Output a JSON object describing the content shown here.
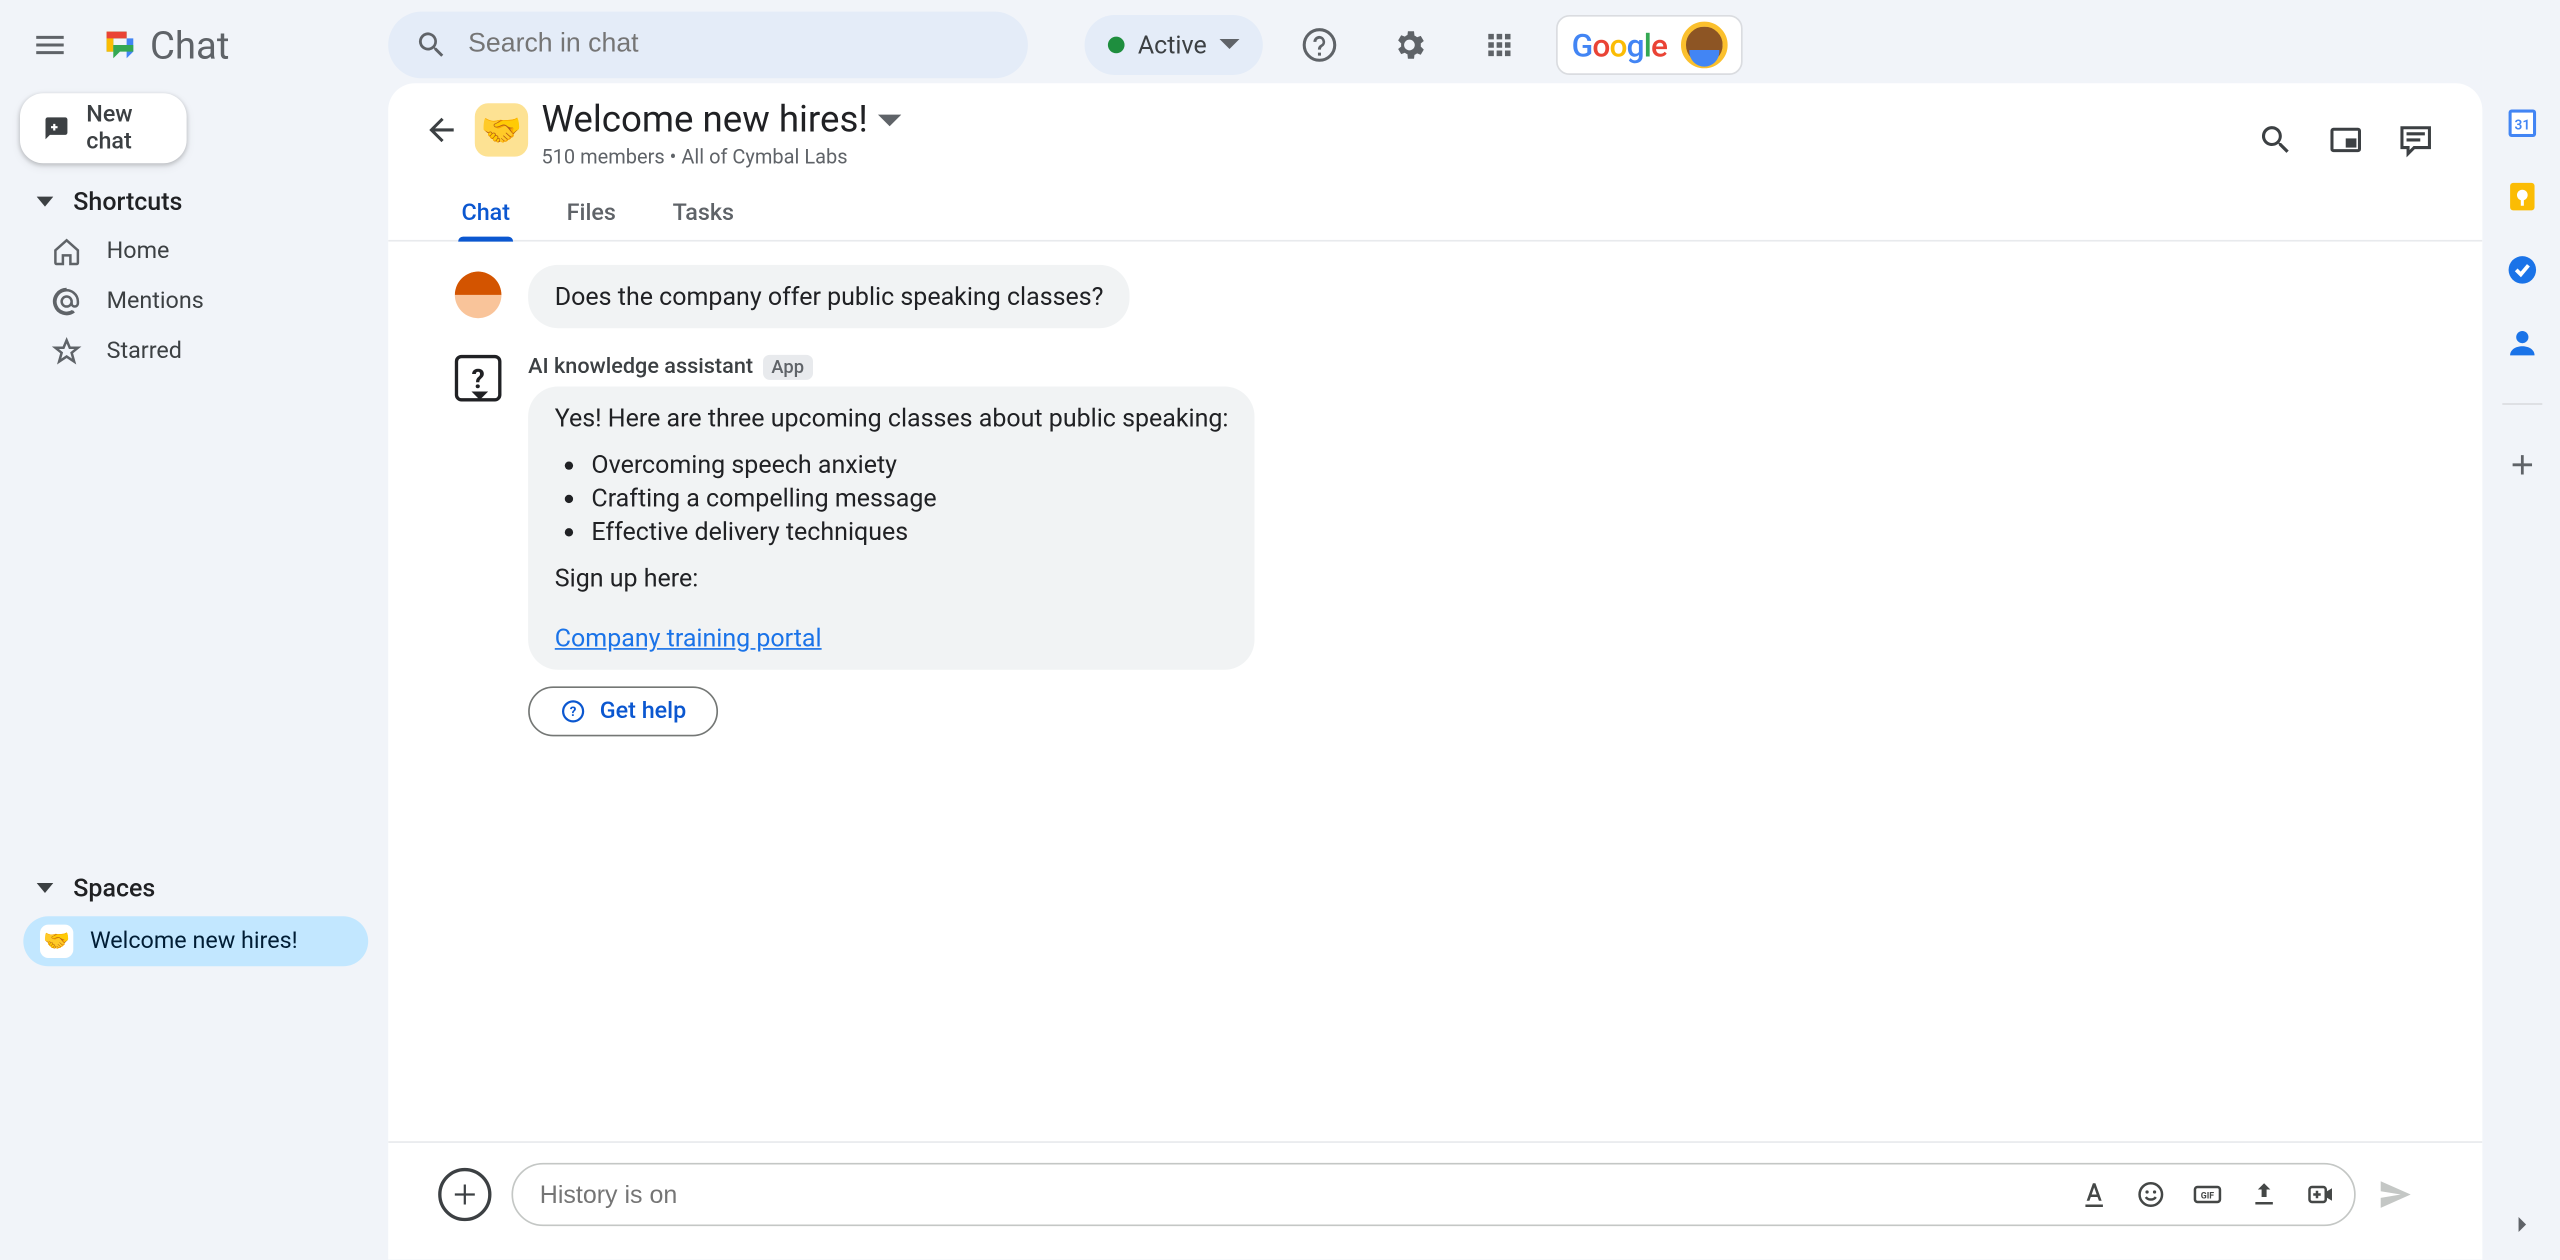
{
  "app": {
    "name": "Chat"
  },
  "search": {
    "placeholder": "Search in chat"
  },
  "status": {
    "label": "Active"
  },
  "sidebar": {
    "newChat": "New chat",
    "shortcutsHeader": "Shortcuts",
    "shortcuts": [
      {
        "label": "Home"
      },
      {
        "label": "Mentions"
      },
      {
        "label": "Starred"
      }
    ],
    "spacesHeader": "Spaces",
    "spaces": [
      {
        "label": "Welcome new hires!",
        "emoji": "🤝"
      }
    ]
  },
  "space": {
    "emoji": "🤝",
    "title": "Welcome new hires!",
    "subtitle": "510 members  •  All of Cymbal Labs",
    "tabs": [
      "Chat",
      "Files",
      "Tasks"
    ]
  },
  "thread": {
    "userMessage": "Does the company offer public speaking classes?",
    "bot": {
      "name": "AI knowledge assistant",
      "badge": "App",
      "intro": "Yes! Here are three upcoming classes about public speaking:",
      "items": [
        "Overcoming speech anxiety",
        "Crafting a compelling message",
        "Effective delivery techniques"
      ],
      "signup": "Sign up here:",
      "link": "Company training portal",
      "helpLabel": "Get help"
    }
  },
  "composer": {
    "placeholder": "History is on"
  }
}
